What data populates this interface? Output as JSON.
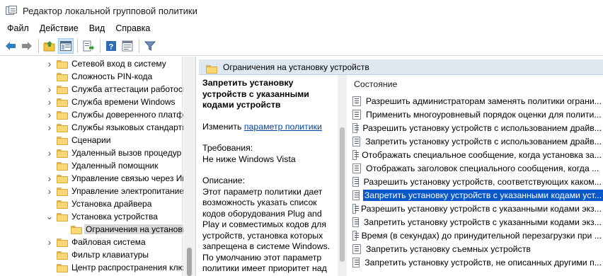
{
  "window": {
    "title": "Редактор локальной групповой политики"
  },
  "menu": [
    "Файл",
    "Действие",
    "Вид",
    "Справка"
  ],
  "toolbar": {
    "icons": [
      "back-arrow-icon",
      "forward-arrow-icon",
      "up-folder-icon",
      "show-hide-tree-icon",
      "export-list-icon",
      "help-icon",
      "properties-icon",
      "filter-icon"
    ]
  },
  "tree": {
    "items": [
      {
        "label": "Сетевой вход в систему",
        "expandable": true
      },
      {
        "label": "Сложность PIN-кода",
        "expandable": false
      },
      {
        "label": "Служба аттестации работоспособности",
        "expandable": true
      },
      {
        "label": "Служба времени Windows",
        "expandable": true
      },
      {
        "label": "Службы доверенного платформенного",
        "expandable": true
      },
      {
        "label": "Службы языковых стандартов",
        "expandable": true
      },
      {
        "label": "Сценарии",
        "expandable": false
      },
      {
        "label": "Удаленный вызов процедур",
        "expandable": true
      },
      {
        "label": "Удаленный помощник",
        "expandable": false
      },
      {
        "label": "Управление связью через Интернет",
        "expandable": true
      },
      {
        "label": "Управление электропитанием",
        "expandable": true
      },
      {
        "label": "Установка драйвера",
        "expandable": false
      },
      {
        "label": "Установка устройства",
        "expandable": true,
        "expanded": true
      },
      {
        "label": "Ограничения на установку устройств",
        "expandable": false,
        "selected": true,
        "child": true
      },
      {
        "label": "Файловая система",
        "expandable": true
      },
      {
        "label": "Фильтр клавиатуры",
        "expandable": false
      },
      {
        "label": "Центр распространения ключей",
        "expandable": false
      }
    ]
  },
  "right": {
    "header_title": "Ограничения на установку устройств",
    "description": {
      "title": "Запретить установку устройств с указанными кодами устройств",
      "edit_prefix": "Изменить ",
      "edit_link": "параметр политики",
      "requirements_label": "Требования:",
      "requirements_value": "Не ниже Windows Vista",
      "description_label": "Описание:",
      "description_text": "Этот параметр политики дает возможность указать список кодов оборудования Plug and Play и совместимых кодов для устройств, установка которых запрещена в системе Windows. По умолчанию этот параметр политики имеет приоритет над любыми другими параметрами"
    },
    "list": {
      "column_header": "Состояние",
      "rows": [
        {
          "label": "Разрешить администраторам заменять политики ограни..."
        },
        {
          "label": "Применить многоуровневый порядок оценки для полити..."
        },
        {
          "label": "Разрешить установку устройств с использованием драйв..."
        },
        {
          "label": "Запретить установку устройств с использованием драйв..."
        },
        {
          "label": "Отображать специальное сообщение, когда установка за..."
        },
        {
          "label": "Отображать заголовок специального сообщения, когда ..."
        },
        {
          "label": "Разрешить установку устройств, соответствующих каком..."
        },
        {
          "label": "Запретить установку устройств с указанными кодами уст...",
          "selected": true
        },
        {
          "label": "Разрешить установку устройств с указанными кодами экз..."
        },
        {
          "label": "Запретить установку устройств с указанными кодами экз..."
        },
        {
          "label": "Время (в секундах) до принудительной перезагрузки при ..."
        },
        {
          "label": "Запретить установку съемных устройств"
        },
        {
          "label": "Запретить установку устройств, не описанных другими п..."
        }
      ]
    }
  }
}
